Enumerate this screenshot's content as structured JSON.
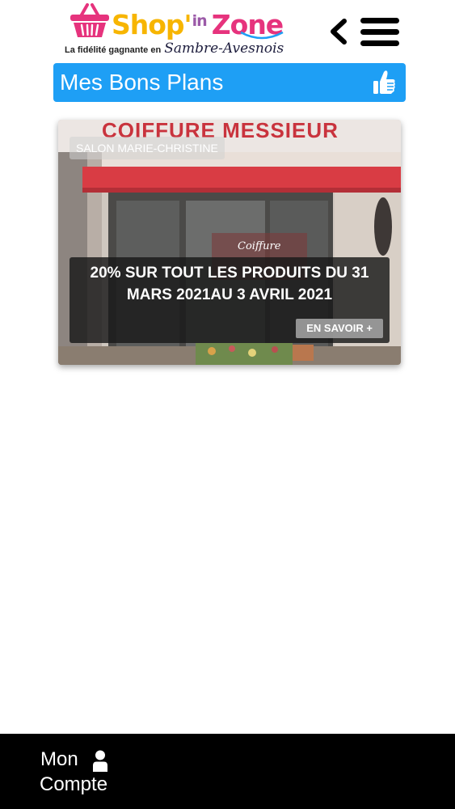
{
  "header": {
    "logo": {
      "word_shop": "Shop'",
      "word_in": "in",
      "word_zone": "Zone",
      "tagline": "La fidélité gagnante en",
      "tagline_script": "Sambre-Avesnois"
    },
    "back_icon": "chevron-left-icon",
    "menu_icon": "hamburger-menu-icon"
  },
  "title_bar": {
    "title": "Mes Bons Plans",
    "icon": "thumbs-up-icon",
    "color": "#1e9ff5"
  },
  "deals": [
    {
      "photo_sign_text": "COIFFURE MESSIEUR",
      "merchant": "SALON MARIE-CHRISTINE",
      "offer": "20% SUR TOUT LES PRODUITS DU 31 MARS 2021AU 3 AVRIL 2021",
      "cta": "EN SAVOIR +"
    }
  ],
  "bottom_bar": {
    "account_line1": "Mon",
    "account_line2": "Compte",
    "account_icon": "user-icon",
    "color": "#000000"
  }
}
